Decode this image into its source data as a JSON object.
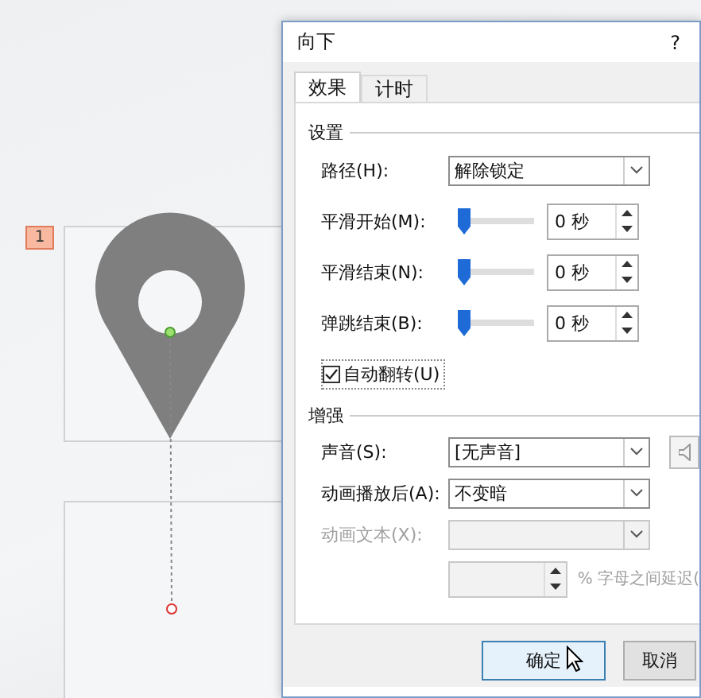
{
  "slide": {
    "badge": "1"
  },
  "dialog": {
    "title": "向下",
    "help": "?",
    "tabs": [
      {
        "label": "效果",
        "selected": true
      },
      {
        "label": "计时",
        "selected": false
      }
    ],
    "settings": {
      "heading": "设置",
      "rows": [
        {
          "kind": "dropdown",
          "label": "路径(H):",
          "value": "解除锁定",
          "disabled": false
        },
        {
          "kind": "slider",
          "label": "平滑开始(M):",
          "level": 0,
          "value": "0 秒"
        },
        {
          "kind": "slider",
          "label": "平滑结束(N):",
          "level": 0,
          "value": "0 秒"
        },
        {
          "kind": "slider",
          "label": "弹跳结束(B):",
          "level": 0,
          "value": "0 秒"
        },
        {
          "kind": "checkbox",
          "label": "自动翻转(U)",
          "checked": true
        }
      ]
    },
    "enhancements": {
      "heading": "增强",
      "rows": [
        {
          "kind": "sound",
          "label": "声音(S):",
          "value": "[无声音]",
          "disabled": false
        },
        {
          "kind": "dropdown",
          "label": "动画播放后(A):",
          "value": "不变暗",
          "disabled": false
        },
        {
          "kind": "dropdown",
          "label": "动画文本(X):",
          "disabled": true
        },
        {
          "kind": "spin",
          "suffix": "% 字母之间延迟(",
          "disabled": true
        }
      ]
    },
    "buttons": [
      {
        "label": "确定",
        "selected": true
      },
      {
        "label": "取消",
        "selected": false
      }
    ]
  }
}
